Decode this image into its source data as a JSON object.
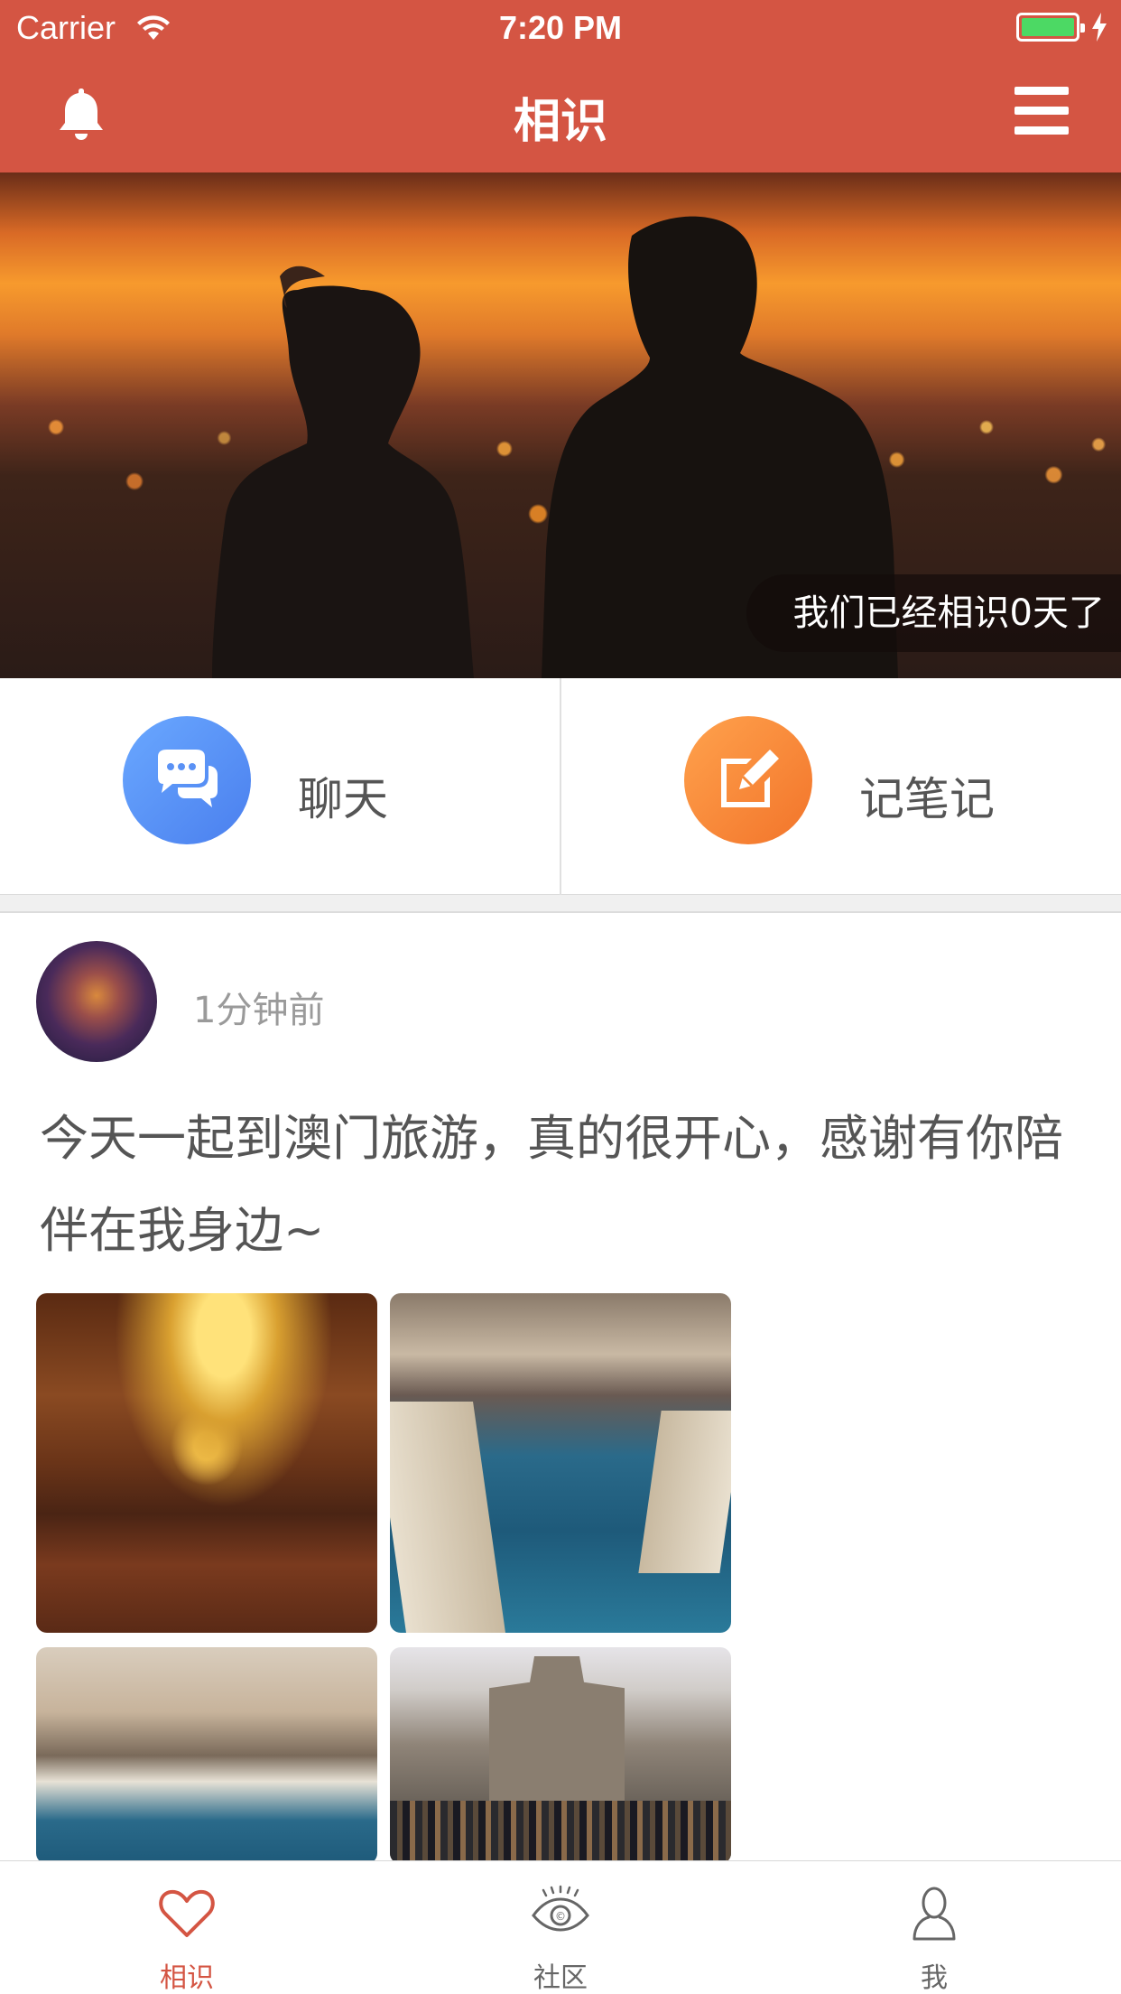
{
  "status_bar": {
    "carrier": "Carrier",
    "time": "7:20 PM"
  },
  "nav": {
    "title": "相识",
    "left_icon": "bell-icon",
    "right_icon": "menu-icon"
  },
  "hero": {
    "caption": "我们已经相识0天了"
  },
  "actions": [
    {
      "label": "聊天",
      "icon": "chat-bubbles-icon",
      "color": "#5b92f5"
    },
    {
      "label": "记笔记",
      "icon": "pencil-note-icon",
      "color": "#f58a3a"
    }
  ],
  "post": {
    "time": "1分钟前",
    "text": "今天一起到澳门旅游，真的很开心，感谢有你陪伴在我身边~",
    "photos": [
      "photo-chandelier-hall",
      "photo-venetian-canal",
      "photo-gondola-bridge",
      "photo-st-paul-ruins"
    ]
  },
  "tabbar": {
    "items": [
      {
        "label": "相识",
        "icon": "heart-icon",
        "active": true
      },
      {
        "label": "社区",
        "icon": "eye-icon",
        "active": false
      },
      {
        "label": "我",
        "icon": "person-icon",
        "active": false
      }
    ]
  },
  "colors": {
    "brand": "#d45543",
    "chat": "#5b92f5",
    "note": "#f58a3a",
    "battery": "#4cd964"
  }
}
